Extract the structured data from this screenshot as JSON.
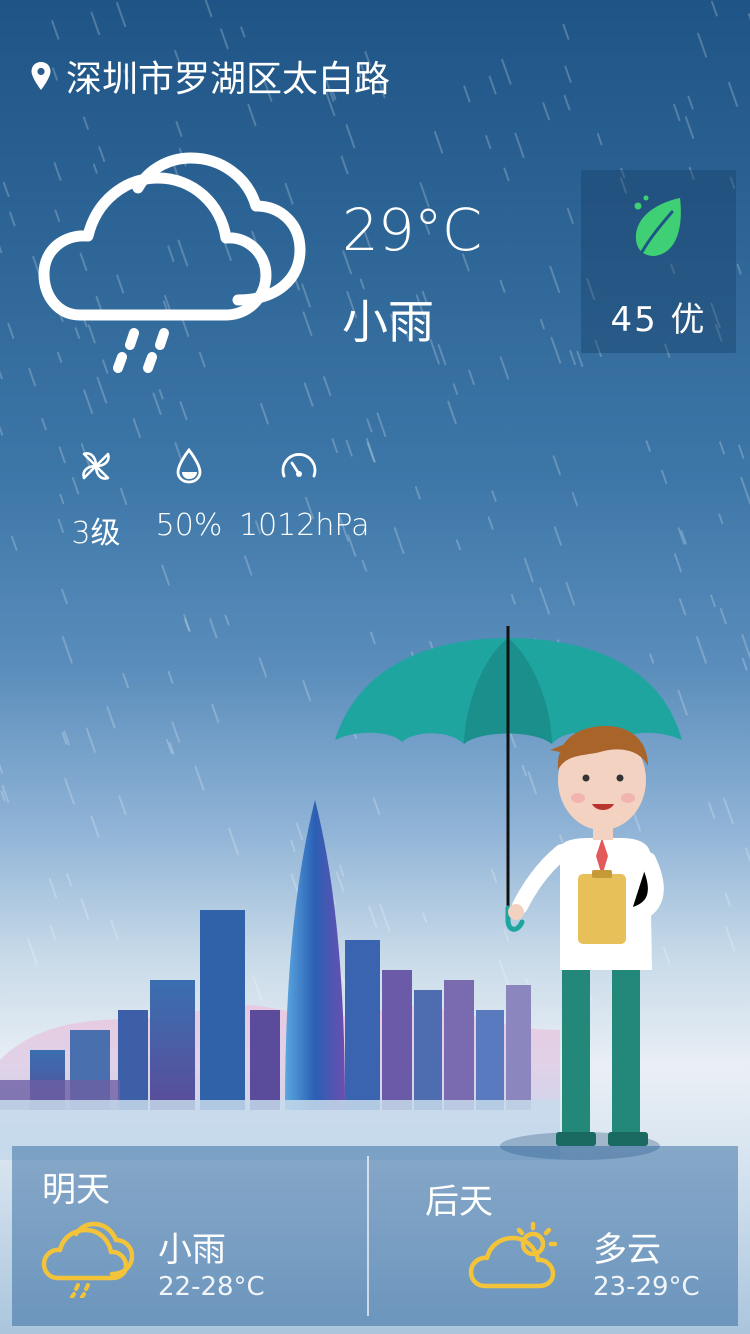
{
  "location": {
    "icon": "location-pin-icon",
    "name": "深圳市罗湖区太白路"
  },
  "current": {
    "icon": "cloud-rain-icon",
    "temperature": "29°C",
    "condition": "小雨"
  },
  "aqi": {
    "icon": "leaf-icon",
    "value": "45 优",
    "color": "#3fcf75"
  },
  "stats": [
    {
      "icon": "wind-icon",
      "value": "3级"
    },
    {
      "icon": "humidity-drop-icon",
      "value": "50%"
    },
    {
      "icon": "pressure-gauge-icon",
      "value": "1012hPa"
    }
  ],
  "forecast": [
    {
      "label": "明天",
      "icon": "cloud-rain-icon",
      "condition": "小雨",
      "range": "22-28°C"
    },
    {
      "label": "后天",
      "icon": "partly-cloudy-icon",
      "condition": "多云",
      "range": "23-29°C"
    }
  ],
  "colors": {
    "icon_yellow": "#f3c43a",
    "umbrella": "#1fa5a0"
  }
}
